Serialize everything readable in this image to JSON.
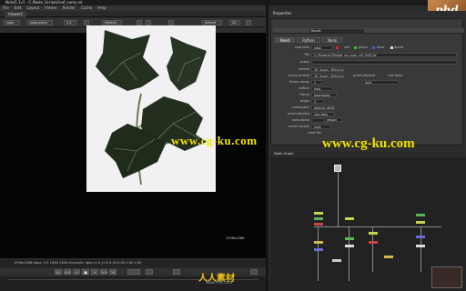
{
  "app": {
    "title": "Nuke5.1v1 - C:/Nuke_Scripts/leaf_comp.nk",
    "brand": "phd"
  },
  "menu": [
    "File",
    "Edit",
    "Layout",
    "Viewer",
    "Render",
    "Cache",
    "Help"
  ],
  "viewer": {
    "tab": "Viewer1",
    "toolbar": {
      "channels": "rgba",
      "layer": "rgba.alpha",
      "zoom": "1:2",
      "frame": "Default",
      "fps": "24",
      "proxy": "default"
    },
    "info": "1556x2366  bbox: 0 0 1556 2366  channels: rgba  x=0 y=0  0.00 0.00 0.00 0.00",
    "resolution": "1556x2366",
    "watermark": "www.cg-ku.com",
    "timeline_buttons": [
      "|<",
      "<<",
      "<",
      "■",
      ">",
      ">>",
      ">|"
    ]
  },
  "properties": {
    "title": "Properties",
    "node_name": "Read1",
    "tabs": [
      "Read",
      "Python",
      "Node"
    ],
    "active_tab": "Read",
    "fields": [
      {
        "label": "channels",
        "value": "rgba"
      },
      {
        "label": "file",
        "value": "C:/Projects/TN/leaf_ivy_scan_ref_0001.tif"
      },
      {
        "label": "proxy",
        "value": ""
      },
      {
        "label": "format",
        "value": "2K_Super_35(full-ap)"
      },
      {
        "label": "proxy format",
        "value": "1K_Super_35(full-ap)"
      },
      {
        "label": "frame range",
        "value": "1"
      },
      {
        "label": "before",
        "value": "hold"
      },
      {
        "label": "after",
        "value": "hold"
      },
      {
        "label": "frame",
        "value": "expression"
      },
      {
        "label": "origin",
        "value": "0"
      },
      {
        "label": "colorspace",
        "value": "default (sRGB)"
      },
      {
        "label": "premultiplied",
        "value": "raw data"
      },
      {
        "label": "auto alpha",
        "value": ""
      },
      {
        "label": "version",
        "value": "reload"
      },
      {
        "label": "cache locally",
        "value": "auto"
      }
    ],
    "checkboxes": [
      "red",
      "green",
      "blue",
      "alpha"
    ],
    "extras": [
      "premultiplied",
      "raw data",
      "read file"
    ],
    "watermark": "www.cg-ku.com"
  },
  "node_graph": {
    "title": "Node Graph"
  },
  "site_logo": {
    "text": "人人素材",
    "sub": "www.rr-sc.com"
  }
}
